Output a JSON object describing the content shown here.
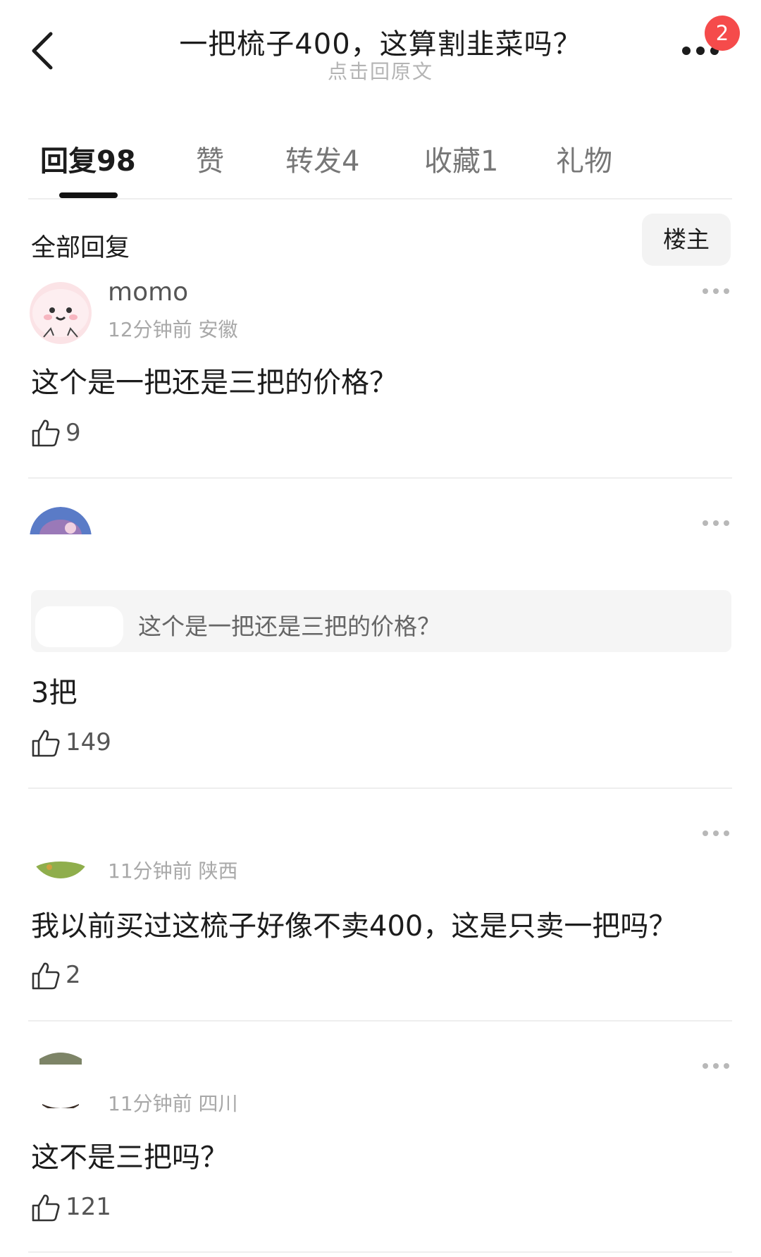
{
  "header": {
    "title": "一把梳子400，这算割韭菜吗？",
    "subtitle": "点击回原文",
    "notification_count": "2"
  },
  "tabs": [
    {
      "label": "回复98"
    },
    {
      "label": "赞"
    },
    {
      "label": "转发4"
    },
    {
      "label": "收藏1"
    },
    {
      "label": "礼物"
    }
  ],
  "section": {
    "title": "全部回复",
    "sort_label": "楼主"
  },
  "comments": [
    {
      "username": "momo",
      "meta": "12分钟前 安徽",
      "text": "这个是一把还是三把的价格？",
      "likes": "9"
    },
    {
      "username": "",
      "meta": "",
      "quote": "这个是一把还是三把的价格？",
      "text": "3把",
      "likes": "149"
    },
    {
      "username": "",
      "meta": "11分钟前 陕西",
      "text": "我以前买过这梳子好像不卖400，这是只卖一把吗？",
      "likes": "2"
    },
    {
      "username": "",
      "meta": "11分钟前 四川",
      "text": "这不是三把吗？",
      "likes": "121"
    }
  ],
  "colors": {
    "badge": "#f54b4b",
    "divider": "#eeeeee",
    "quote_bg": "#f5f5f5"
  }
}
